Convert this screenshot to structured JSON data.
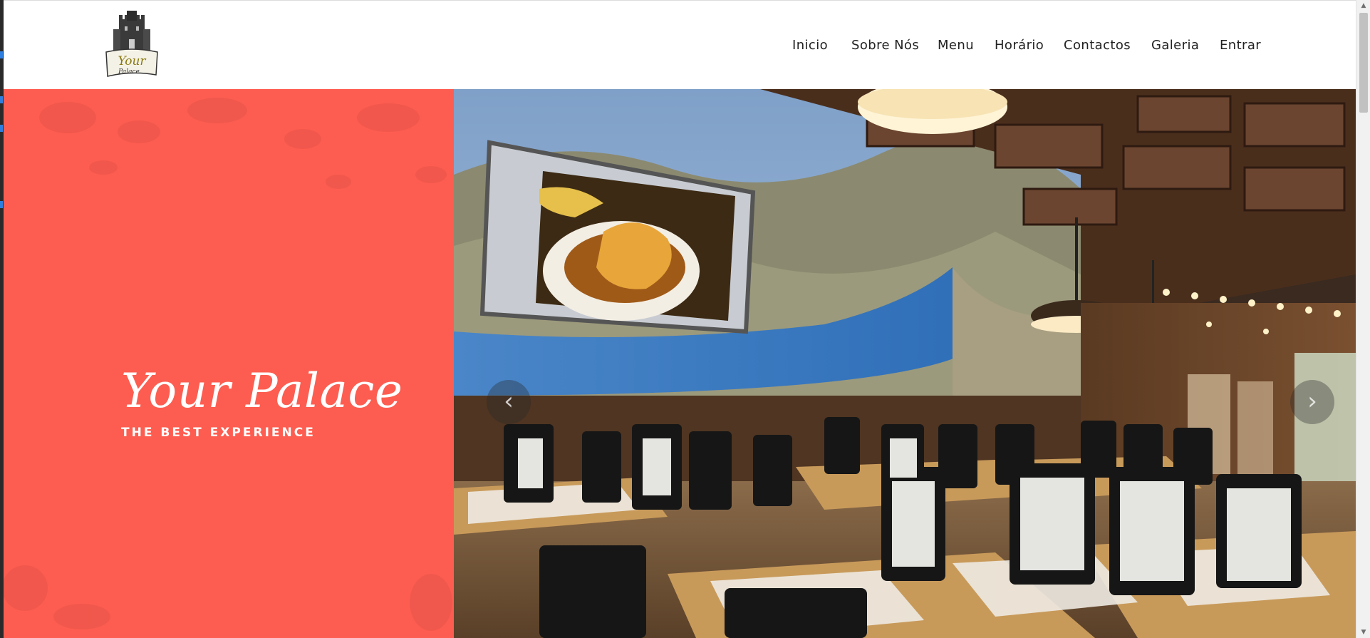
{
  "brand": {
    "name": "Your Palace",
    "logo_text": "Your",
    "logo_subtext": "Palace"
  },
  "nav": {
    "items": [
      {
        "label": "Inicio"
      },
      {
        "label": "Sobre Nós"
      },
      {
        "label": "Menu"
      },
      {
        "label": "Horário"
      },
      {
        "label": "Contactos"
      },
      {
        "label": "Galeria"
      },
      {
        "label": "Entrar"
      }
    ]
  },
  "hero": {
    "title": "Your Palace",
    "subtitle": "THE BEST EXPERIENCE",
    "prev_icon": "‹",
    "next_icon": "›"
  },
  "colors": {
    "accent": "#fd5d50",
    "nav_text": "#222222",
    "header_bg": "#ffffff"
  },
  "icons": {
    "logo": "castle-logo-icon",
    "prev": "chevron-left-icon",
    "next": "chevron-right-icon"
  }
}
